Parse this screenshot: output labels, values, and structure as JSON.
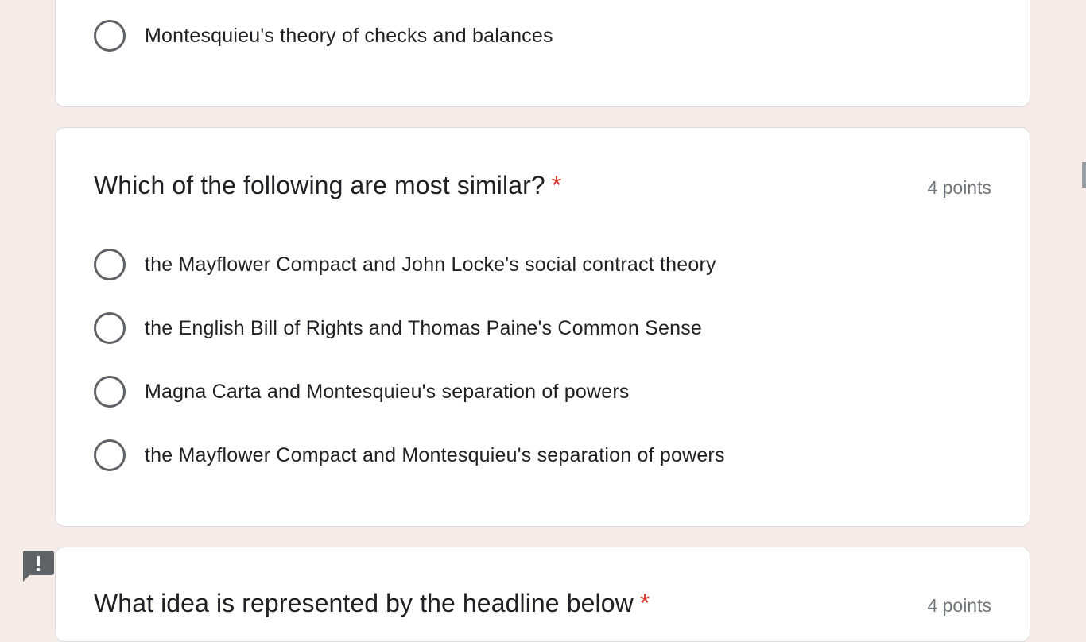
{
  "previous_question": {
    "last_option": "Montesquieu's theory of checks and balances"
  },
  "question": {
    "title": "Which of the following are most similar?",
    "required_marker": "*",
    "points": "4 points",
    "options": [
      "the Mayflower Compact and John Locke's social contract theory",
      "the English Bill of Rights and Thomas Paine's Common Sense",
      "Magna Carta and Montesquieu's separation of powers",
      "the Mayflower Compact and Montesquieu's separation of powers"
    ]
  },
  "next_question": {
    "title": "What idea is represented by the headline below",
    "required_marker": "*",
    "points": "4 points"
  },
  "colors": {
    "page_background": "#f6ebe6",
    "required": "#d93025",
    "radio_border": "#5f6368"
  },
  "icons": {
    "feedback": "report-feedback-icon"
  }
}
